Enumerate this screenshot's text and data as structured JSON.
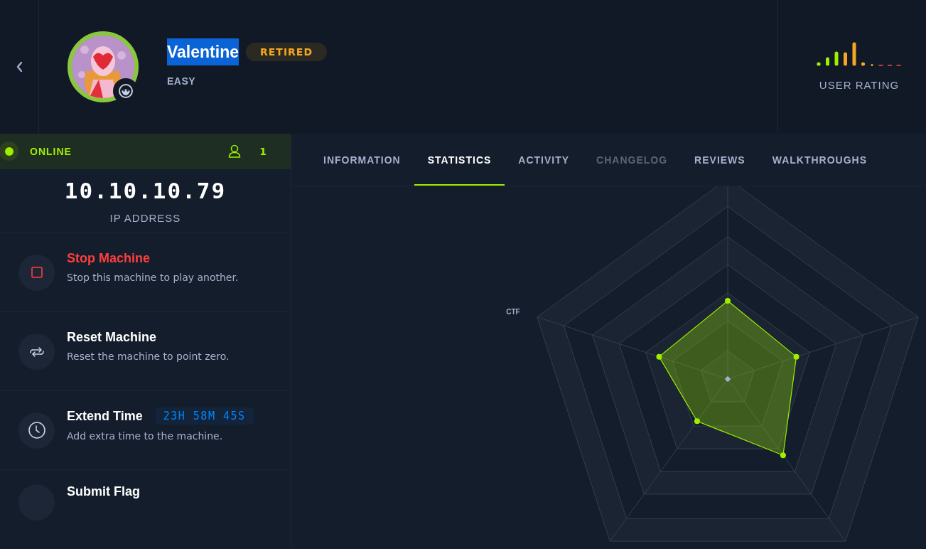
{
  "header": {
    "machine": {
      "name": "Valentine",
      "status_badge": "RETIRED",
      "difficulty": "EASY"
    },
    "user_rating": {
      "label": "USER RATING"
    }
  },
  "status": {
    "label": "ONLINE",
    "online": true,
    "players": "1"
  },
  "ip": {
    "value": "10.10.10.79",
    "label": "IP ADDRESS"
  },
  "actions": [
    {
      "kind": "stop",
      "title": "Stop Machine",
      "description": "Stop this machine to play another."
    },
    {
      "kind": "reset",
      "title": "Reset Machine",
      "description": "Reset the machine to point zero."
    },
    {
      "kind": "extend",
      "title": "Extend Time",
      "timer": "23H 58M 45S",
      "description": "Add extra time to the machine."
    },
    {
      "kind": "submit",
      "title": "Submit Flag"
    }
  ],
  "tabs": [
    {
      "label": "INFORMATION",
      "selected": false,
      "disabled": false
    },
    {
      "label": "STATISTICS",
      "selected": true,
      "disabled": false
    },
    {
      "label": "ACTIVITY",
      "selected": false,
      "disabled": false
    },
    {
      "label": "CHANGELOG",
      "selected": false,
      "disabled": true
    },
    {
      "label": "REVIEWS",
      "selected": false,
      "disabled": false
    },
    {
      "label": "WALKTHROUGHS",
      "selected": false,
      "disabled": false
    }
  ],
  "statistics": {
    "axis_labels": [
      "CTF"
    ]
  }
}
